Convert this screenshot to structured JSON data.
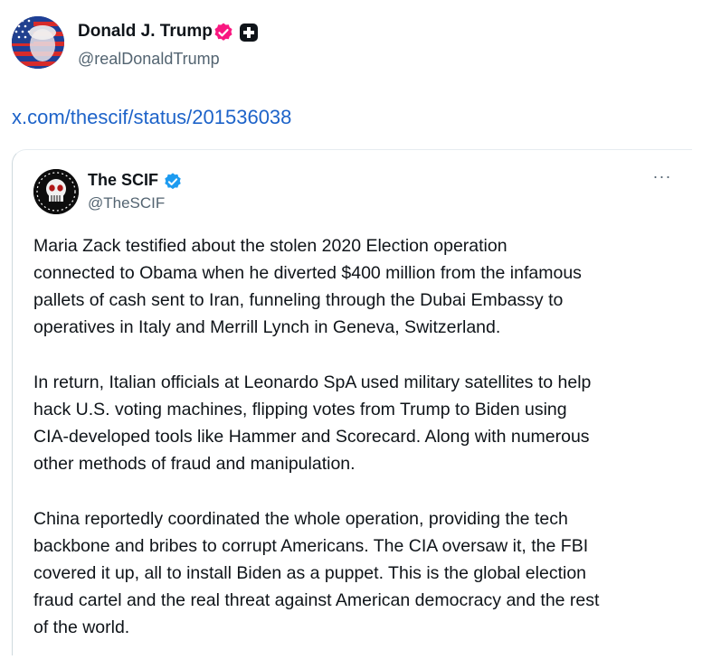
{
  "post": {
    "author": {
      "name": "Donald J. Trump",
      "handle": "@realDonaldTrump",
      "verified_color": "#f91880"
    },
    "link_text": "x.com/thescif/status/201536038"
  },
  "quoted_post": {
    "author": {
      "name": "The SCIF",
      "handle": "@TheSCIF",
      "verified_color": "#1d9bf0"
    },
    "more_label": "···",
    "paragraphs": [
      "Maria Zack testified about the stolen 2020 Election operation\nconnected to Obama when he diverted $400 million from the infamous\npallets of cash sent to Iran, funneling through the Dubai Embassy to\noperatives in Italy and Merrill Lynch in Geneva, Switzerland.",
      "In return, Italian officials at Leonardo SpA used military satellites to help\nhack U.S. voting machines, flipping votes from Trump to Biden using\nCIA-developed tools like Hammer and Scorecard. Along with numerous\nother methods of fraud and manipulation.",
      "China reportedly coordinated the whole operation, providing the tech\nbackbone and bribes to corrupt Americans. The CIA oversaw it, the FBI\ncovered it up, all to install Biden as a puppet. This is the global election\nfraud cartel and the real threat against American democracy and the rest\nof the world."
    ]
  },
  "icons": {
    "verified": "verified-badge-icon",
    "affiliation": "government-affiliation-icon",
    "more": "more-options-icon"
  }
}
